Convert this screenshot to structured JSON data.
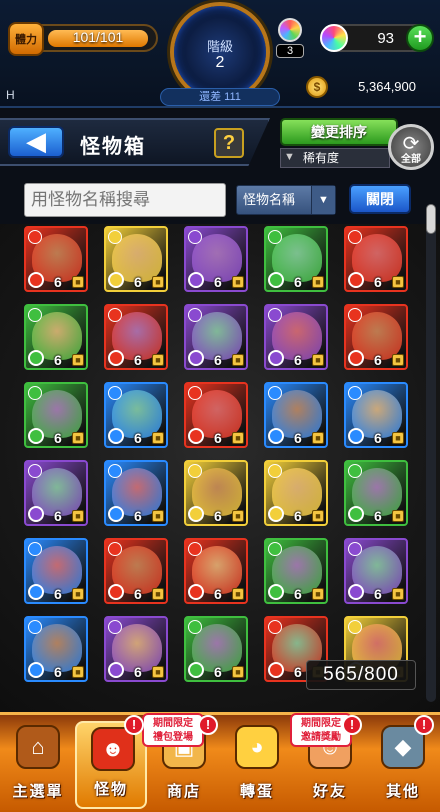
{
  "status": {
    "stamina_label": "體力",
    "stamina_value": "101/101",
    "stamina_fraction": 1.0,
    "rank_label": "階級",
    "rank_value": "2",
    "exp_remaining": "還差 111",
    "orb_count": "3",
    "gem_count": "93",
    "gem_add": "+",
    "h_label": "H",
    "coin_icon": "$",
    "coin_amount": "5,364,900"
  },
  "header": {
    "back_glyph": "◀",
    "title": "怪物箱",
    "help_glyph": "?",
    "sort_button": "變更排序",
    "sort_value": "稀有度",
    "all_button": "全部"
  },
  "search": {
    "placeholder": "用怪物名稱搜尋",
    "field_select": "怪物名稱",
    "close_button": "關閉"
  },
  "monsters": {
    "level": "6",
    "count": "565/800",
    "elements": {
      "fire": "#e8331f",
      "water": "#2a8bff",
      "wood": "#3fbf3f",
      "light": "#f2cf3a",
      "dark": "#8a4ad0"
    },
    "grid": [
      [
        "fire",
        "light",
        "dark",
        "wood",
        "fire"
      ],
      [
        "wood",
        "fire",
        "dark",
        "dark",
        "fire"
      ],
      [
        "wood",
        "water",
        "fire",
        "water",
        "water"
      ],
      [
        "dark",
        "water",
        "light",
        "light",
        "wood"
      ],
      [
        "water",
        "fire",
        "fire",
        "wood",
        "dark"
      ],
      [
        "water",
        "dark",
        "wood",
        "fire",
        "light"
      ]
    ]
  },
  "nav": {
    "items": [
      {
        "label": "主選單",
        "icon": "home-icon"
      },
      {
        "label": "怪物",
        "icon": "monster-icon"
      },
      {
        "label": "商店",
        "icon": "shop-icon"
      },
      {
        "label": "轉蛋",
        "icon": "gacha-icon"
      },
      {
        "label": "好友",
        "icon": "friends-icon"
      },
      {
        "label": "其他",
        "icon": "other-icon"
      }
    ],
    "shop_promo": "期間限定\n禮包登場",
    "friend_promo": "期間限定\n邀請獎勵",
    "alert": "!"
  }
}
